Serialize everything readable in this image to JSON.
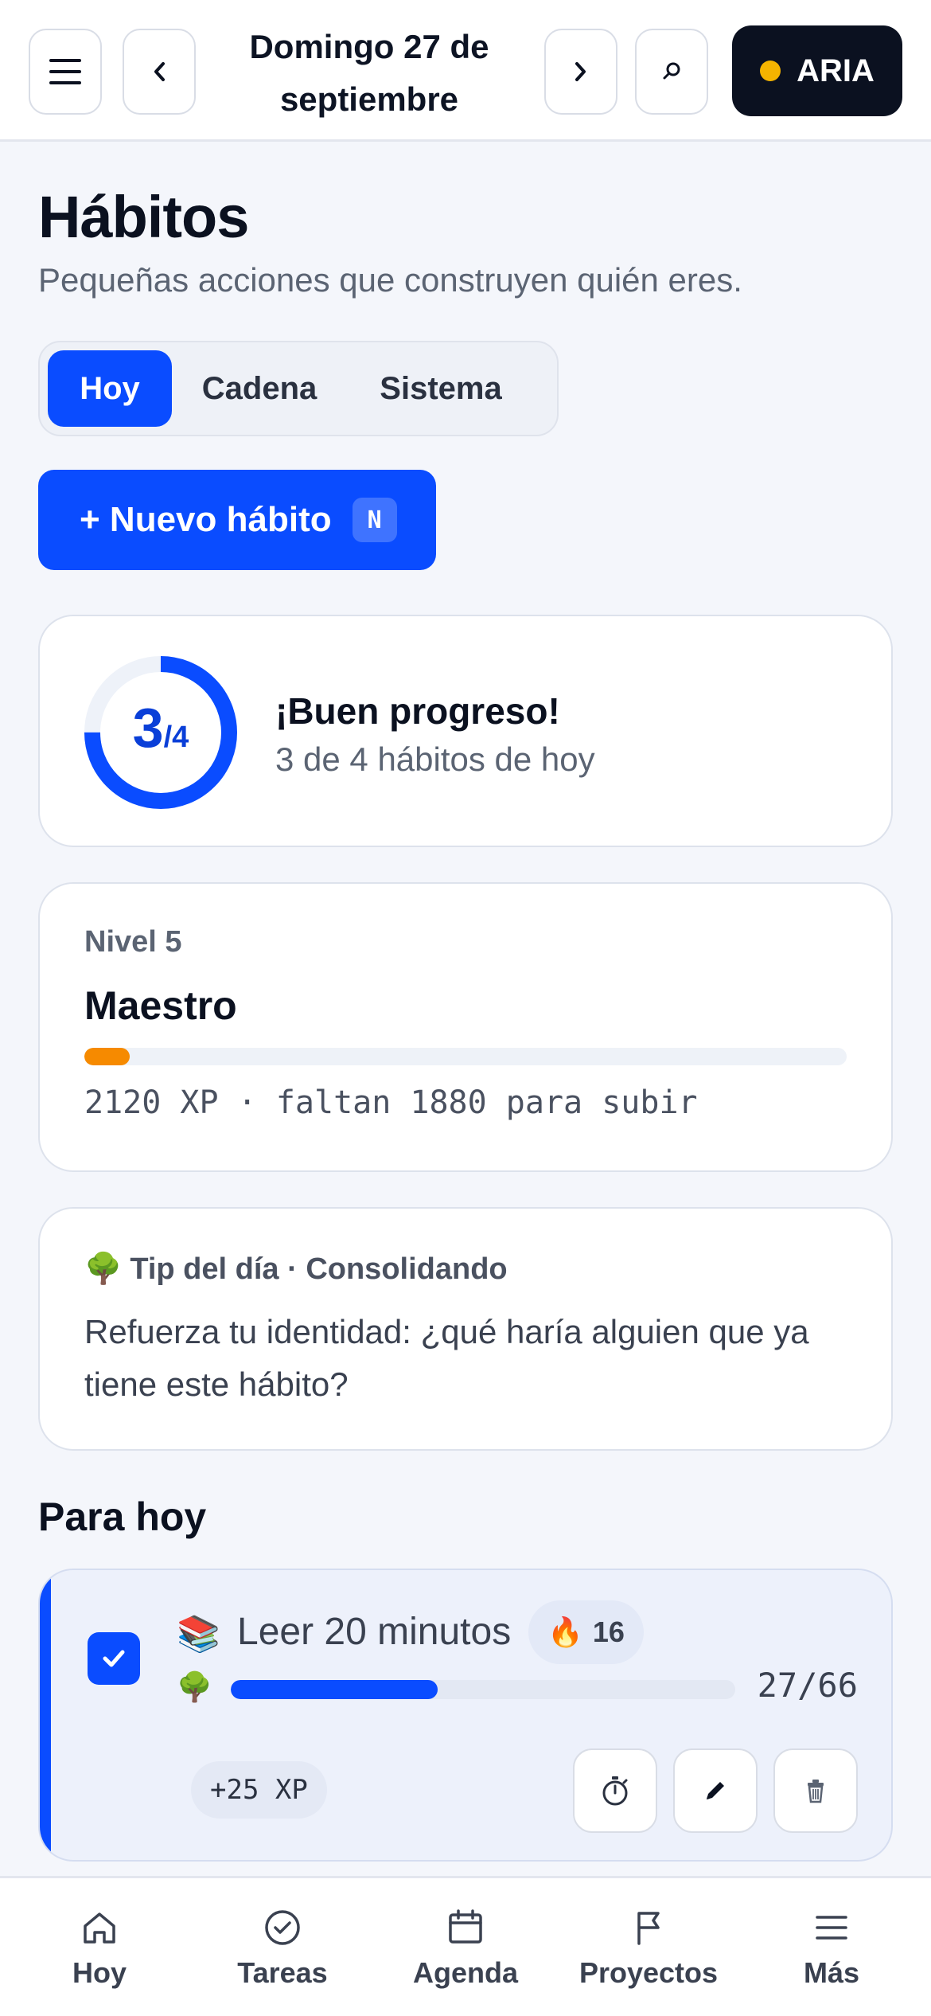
{
  "header": {
    "date_line1": "Domingo 27 de",
    "date_line2": "septiembre",
    "assistant_label": "ARIA"
  },
  "page": {
    "title": "Hábitos",
    "subtitle": "Pequeñas acciones que construyen quién eres."
  },
  "tabs": [
    {
      "label": "Hoy",
      "active": true
    },
    {
      "label": "Cadena",
      "active": false
    },
    {
      "label": "Sistema",
      "active": false
    }
  ],
  "new_habit": {
    "label": "+ Nuevo hábito",
    "shortcut": "N"
  },
  "progress": {
    "done": "3",
    "total_text": "/4",
    "fraction": 0.75,
    "title": "¡Buen progreso!",
    "subtitle": "3 de 4 hábitos de hoy"
  },
  "level": {
    "label": "Nivel 5",
    "title": "Maestro",
    "progress_fraction": 0.06,
    "xp_text": "2120 XP · faltan 1880 para subir"
  },
  "tip": {
    "icon": "🌳",
    "heading": "Tip del día · Consolidando",
    "body": "Refuerza tu identidad: ¿qué haría alguien que ya tiene este hábito?"
  },
  "today": {
    "section_title": "Para hoy",
    "habits": [
      {
        "emoji": "📚",
        "name": "Leer 20 minutos",
        "streak_icon": "🔥",
        "streak": "16",
        "stage_icon": "🌳",
        "progress_fraction": 0.41,
        "count": "27/66",
        "xp": "+25 XP",
        "checked": true
      }
    ]
  },
  "bottom_nav": [
    {
      "label": "Hoy",
      "icon": "home-icon"
    },
    {
      "label": "Tareas",
      "icon": "check-circle-icon"
    },
    {
      "label": "Agenda",
      "icon": "calendar-icon"
    },
    {
      "label": "Proyectos",
      "icon": "flag-icon"
    },
    {
      "label": "Más",
      "icon": "menu-icon"
    }
  ],
  "colors": {
    "accent": "#0a4cff",
    "level_bar": "#f68a00",
    "assistant_dot": "#f5b400",
    "dark": "#0b1120"
  }
}
